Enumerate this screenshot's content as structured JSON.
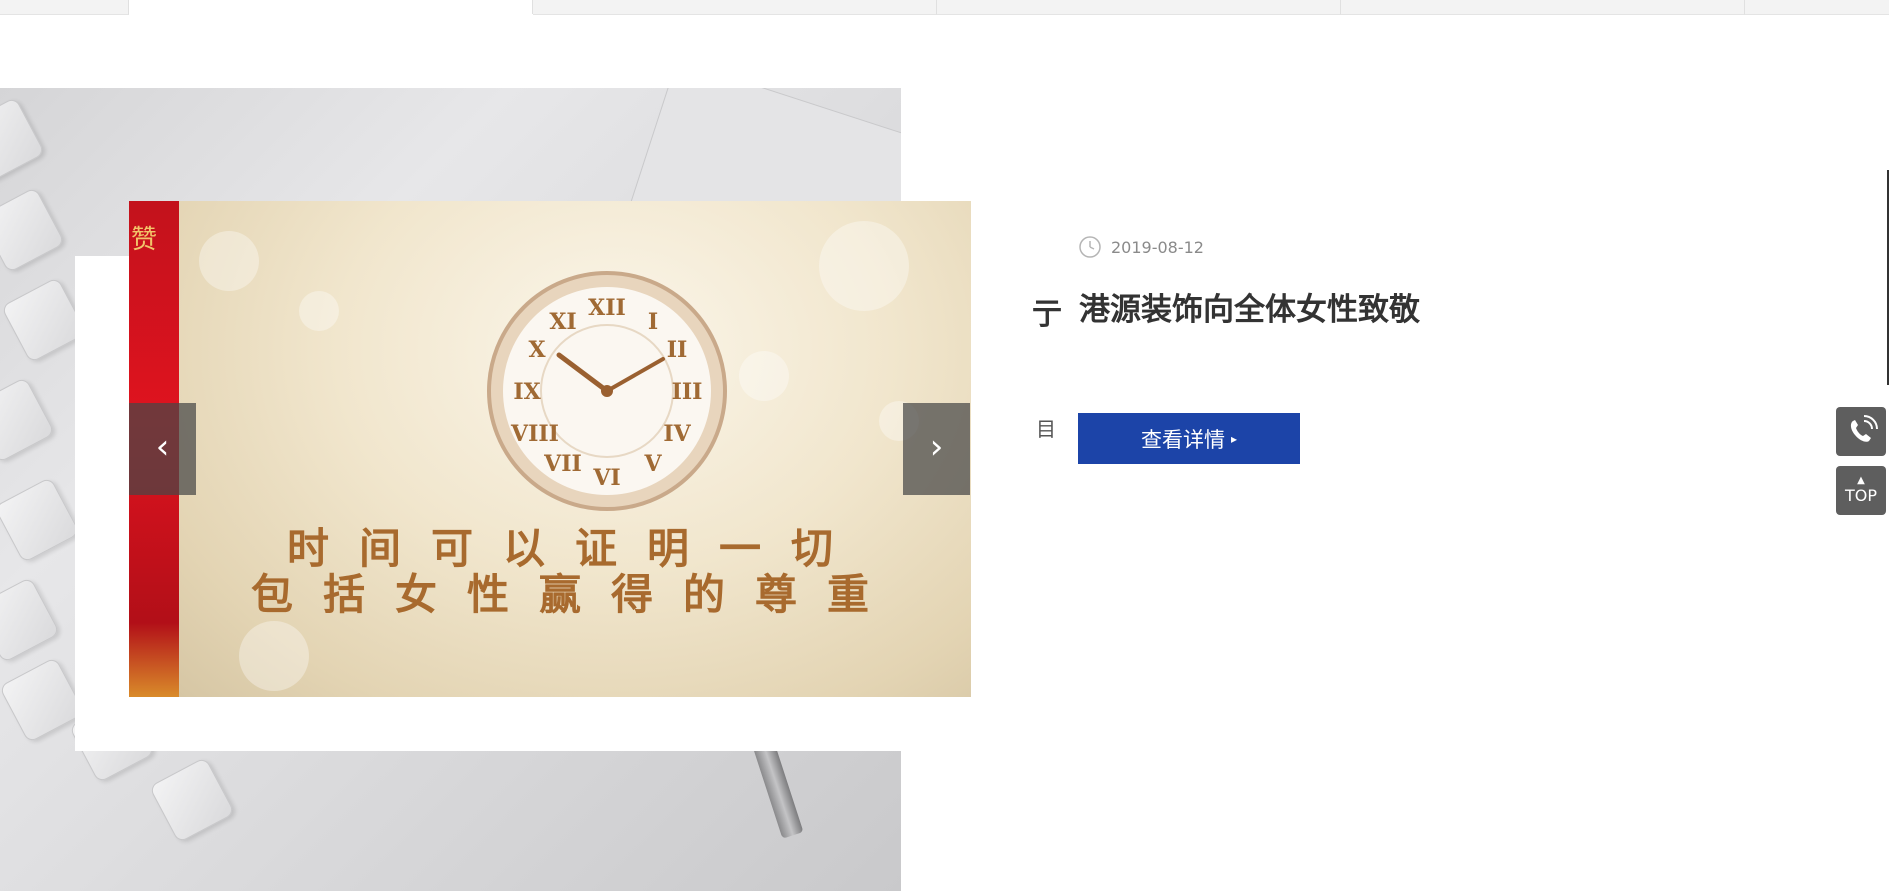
{
  "tabs": [
    "",
    "",
    "",
    "",
    "",
    ""
  ],
  "slider": {
    "poster_line1": "时间可以证明一切",
    "poster_line2": "包括女性赢得的尊重",
    "prev_strip_text": "赞",
    "prev_glyph": "‹",
    "next_glyph": "›"
  },
  "article": {
    "date": "2019-08-12",
    "title": "港源装饰向全体女性致敬",
    "detail_button": "查看详情",
    "prev_title_cut": "亍",
    "prev_text_cut": "目"
  },
  "floating": {
    "top_label": "TOP"
  },
  "colors": {
    "button_blue": "#1c44a8",
    "float_gray": "#5e5e5e",
    "poster_gold": "#a86a2e"
  },
  "icons": [
    "clock-icon",
    "phone-icon",
    "caret-up-icon",
    "chevron-left-icon",
    "chevron-right-icon"
  ]
}
